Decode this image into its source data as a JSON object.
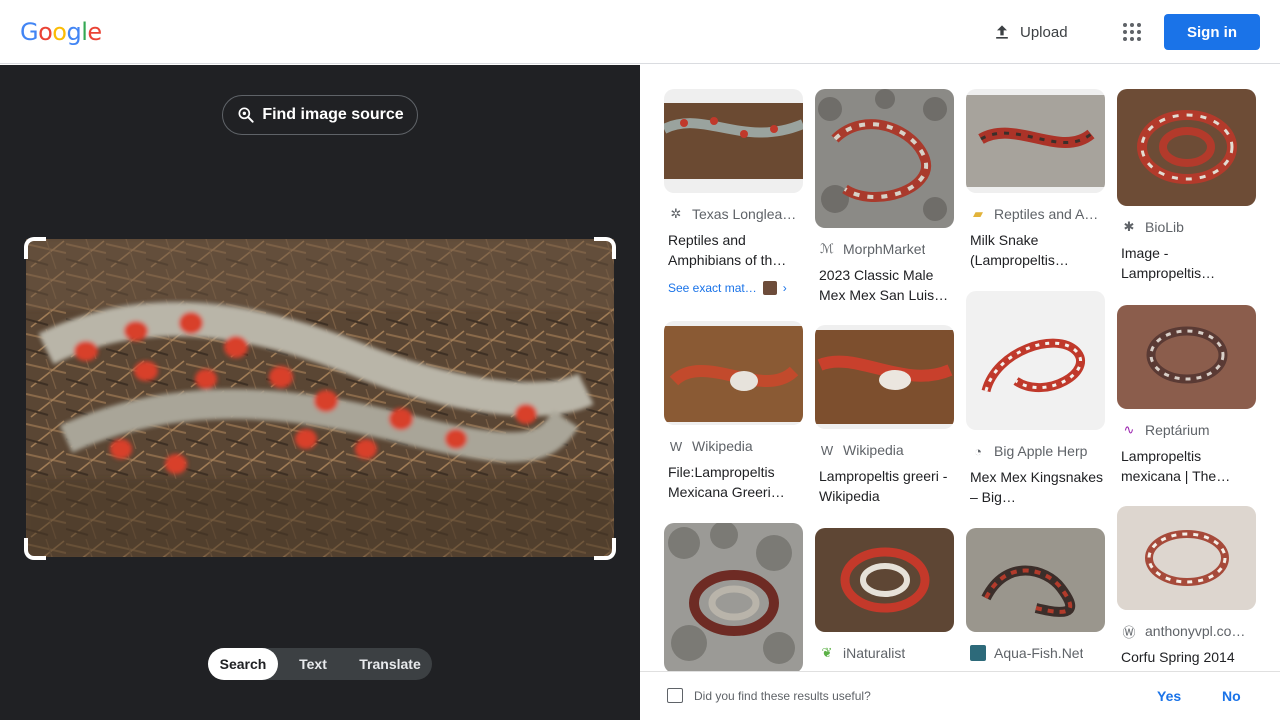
{
  "header": {
    "logo_letters": [
      {
        "ch": "G",
        "color": "#4285F4"
      },
      {
        "ch": "o",
        "color": "#EA4335"
      },
      {
        "ch": "o",
        "color": "#FBBC05"
      },
      {
        "ch": "g",
        "color": "#4285F4"
      },
      {
        "ch": "l",
        "color": "#34A853"
      },
      {
        "ch": "e",
        "color": "#EA4335"
      }
    ],
    "upload_label": "Upload",
    "apps_icon": "apps-grid-icon",
    "signin_label": "Sign in"
  },
  "query": {
    "find_source_label": "Find image source",
    "modes": [
      "Search",
      "Text",
      "Translate"
    ],
    "active_mode": "Search"
  },
  "results": [
    {
      "source": "Texas Longlea…",
      "title": "Reptiles and Amphibians of th…",
      "icon": "texas-longleaf-favicon",
      "exact_match": "See exact mat…"
    },
    {
      "source": "MorphMarket",
      "title": "2023 Classic Male Mex Mex San Luis…",
      "icon": "morphmarket-favicon"
    },
    {
      "source": "Reptiles and A…",
      "title": "Milk Snake (Lampropeltis…",
      "icon": "reptiles-amphibians-favicon"
    },
    {
      "source": "BioLib",
      "title": "Image - Lampropeltis…",
      "icon": "biolib-favicon"
    },
    {
      "source": "Wikipedia",
      "title": "File:Lampropeltis Mexicana Greeri…",
      "icon": "wikipedia-favicon"
    },
    {
      "source": "Wikipedia",
      "title": "Lampropeltis greeri - Wikipedia",
      "icon": "wikipedia-favicon"
    },
    {
      "source": "Big Apple Herp",
      "title": "Mex Mex Kingsnakes – Big…",
      "icon": "big-apple-herp-favicon"
    },
    {
      "source": "Reptárium",
      "title": "Lampropeltis mexicana | The…",
      "icon": "reptarium-favicon"
    },
    {
      "source": "",
      "title": "",
      "icon": ""
    },
    {
      "source": "iNaturalist",
      "title": "",
      "icon": "inaturalist-favicon"
    },
    {
      "source": "Aqua-Fish.Net",
      "title": "",
      "icon": "aqua-fish-favicon"
    },
    {
      "source": "anthonyvpl.co…",
      "title": "Corfu Spring 2014",
      "icon": "anthonyvpl-favicon"
    }
  ],
  "feedback": {
    "question": "Did you find these results useful?",
    "yes": "Yes",
    "no": "No"
  },
  "colors": {
    "accent": "#1a73e8",
    "dark_panel": "#202124"
  }
}
